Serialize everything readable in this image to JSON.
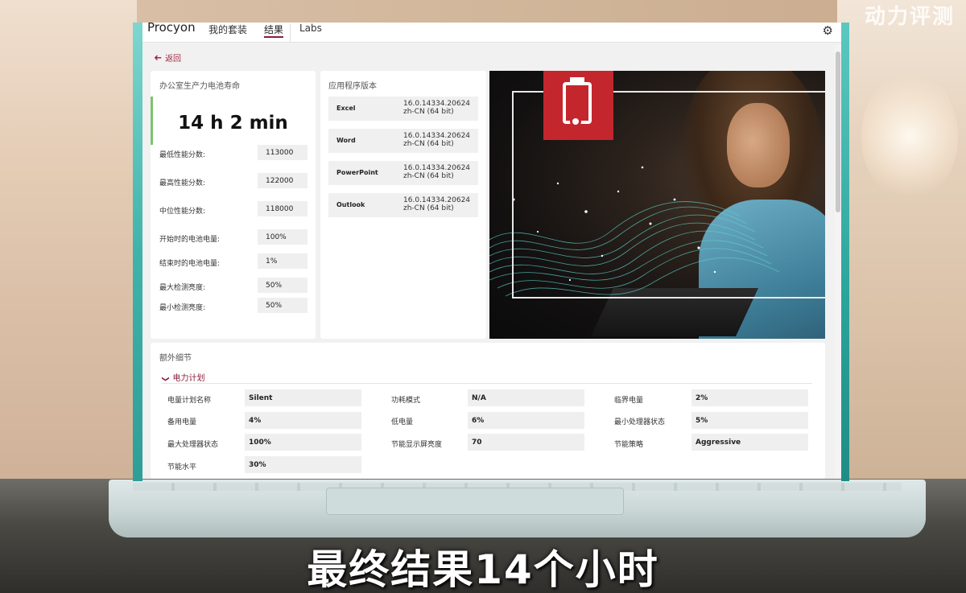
{
  "watermark": "动力评测",
  "caption": "最终结果14个小时",
  "app": {
    "brand": "Procyon",
    "tabs": [
      "我的套装",
      "结果",
      "Labs"
    ],
    "active_tab": "结果",
    "back_label": "返回"
  },
  "battery_card": {
    "title": "办公室生产力电池寿命",
    "result": "14 h 2 min",
    "stats": [
      {
        "label": "最低性能分数:",
        "value": "113000"
      },
      {
        "label": "最高性能分数:",
        "value": "122000"
      },
      {
        "label": "中位性能分数:",
        "value": "118000"
      },
      {
        "label": "开始时的电池电量:",
        "value": "100%"
      },
      {
        "label": "结束时的电池电量:",
        "value": "1%"
      },
      {
        "label": "最大检测亮度:",
        "value": "50%"
      },
      {
        "label": "最小检测亮度:",
        "value": "50%"
      }
    ]
  },
  "versions_card": {
    "title": "应用程序版本",
    "apps": [
      {
        "name": "Excel",
        "version": "16.0.14334.20624",
        "lang": "zh-CN (64 bit)"
      },
      {
        "name": "Word",
        "version": "16.0.14334.20624",
        "lang": "zh-CN (64 bit)"
      },
      {
        "name": "PowerPoint",
        "version": "16.0.14334.20624",
        "lang": "zh-CN (64 bit)"
      },
      {
        "name": "Outlook",
        "version": "16.0.14334.20624",
        "lang": "zh-CN (64 bit)"
      }
    ]
  },
  "extra": {
    "title": "额外细节",
    "section": "电力计划",
    "rows": [
      [
        {
          "label": "电量计划名称",
          "value": "Silent"
        },
        {
          "label": "功耗模式",
          "value": "N/A"
        },
        {
          "label": "临界电量",
          "value": "2%"
        }
      ],
      [
        {
          "label": "备用电量",
          "value": "4%"
        },
        {
          "label": "低电量",
          "value": "6%"
        },
        {
          "label": "最小处理器状态",
          "value": "5%"
        }
      ],
      [
        {
          "label": "最大处理器状态",
          "value": "100%"
        },
        {
          "label": "节能显示屏亮度",
          "value": "70"
        },
        {
          "label": "节能策略",
          "value": "Aggressive"
        }
      ],
      [
        {
          "label": "节能水平",
          "value": "30%"
        }
      ]
    ]
  },
  "colors": {
    "accent": "#8b1d3b",
    "success": "#7cc36c",
    "logo_red": "#c4262e"
  },
  "icons": {
    "back": "arrow-left-icon",
    "settings": "gear-icon",
    "expand": "chevron-down-icon",
    "logo": "battery-logo-icon"
  }
}
